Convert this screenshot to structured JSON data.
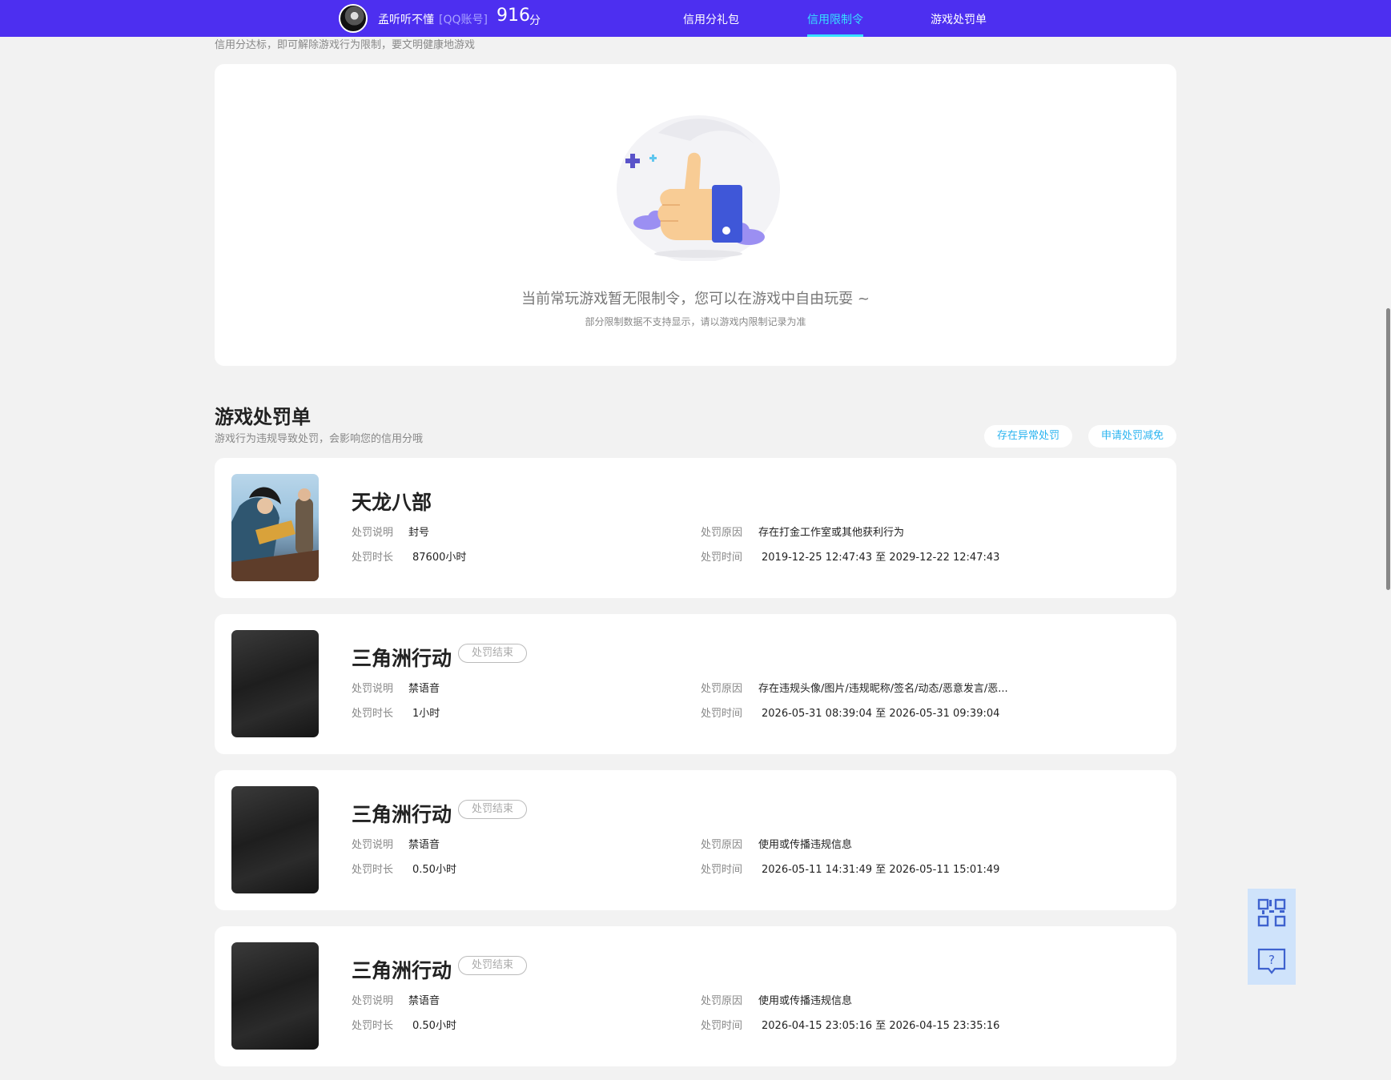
{
  "header": {
    "username": "孟听听不懂",
    "account_type": "[QQ账号]",
    "score": "916",
    "score_unit": "分",
    "nav": [
      "信用分礼包",
      "信用限制令",
      "游戏处罚单"
    ],
    "active_nav": "信用限制令",
    "accent_color": "#4d2ff0",
    "active_color": "#36e0ff"
  },
  "limit_section": {
    "subtitle": "信用分达标，即可解除游戏行为限制，要文明健康地游戏",
    "empty_main": "当前常玩游戏暂无限制令，您可以在游戏中自由玩耍 ~",
    "empty_sub": "部分限制数据不支持显示，请以游戏内限制记录为准"
  },
  "punishment_section": {
    "title": "游戏处罚单",
    "subtitle": "游戏行为违规导致处罚，会影响您的信用分哦",
    "buttons": [
      "存在异常处罚",
      "申请处罚减免"
    ],
    "labels": {
      "desc": "处罚说明",
      "duration": "处罚时长",
      "reason": "处罚原因",
      "time": "处罚时间"
    },
    "records": [
      {
        "game": "天龙八部",
        "status": "",
        "desc": "封号",
        "duration": "87600小时",
        "reason": "存在打金工作室或其他获利行为",
        "time": "2019-12-25 12:47:43 至 2029-12-22 12:47:43"
      },
      {
        "game": "三角洲行动",
        "status": "处罚结束",
        "desc": "禁语音",
        "duration": "1小时",
        "reason": "存在违规头像/图片/违规昵称/签名/动态/恶意发言/恶...",
        "time": "2026-05-31 08:39:04 至 2026-05-31 09:39:04"
      },
      {
        "game": "三角洲行动",
        "status": "处罚结束",
        "desc": "禁语音",
        "duration": "0.50小时",
        "reason": "使用或传播违规信息",
        "time": "2026-05-11 14:31:49 至 2026-05-11 15:01:49"
      },
      {
        "game": "三角洲行动",
        "status": "处罚结束",
        "desc": "禁语音",
        "duration": "0.50小时",
        "reason": "使用或传播违规信息",
        "time": "2026-04-15 23:05:16 至 2026-04-15 23:35:16"
      }
    ]
  },
  "float_tools": [
    "qrcode-icon",
    "help-chat-icon"
  ]
}
